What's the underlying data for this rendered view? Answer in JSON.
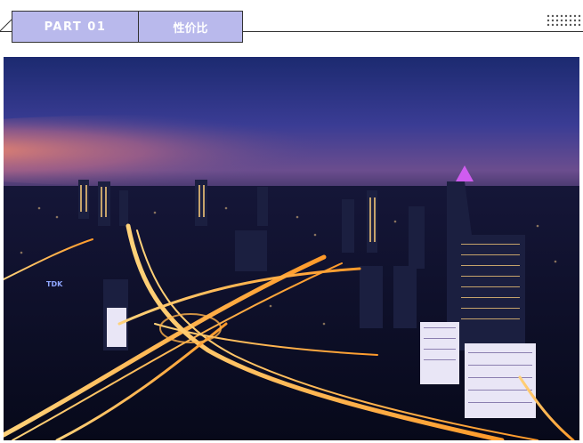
{
  "header": {
    "part_label": "PART  01",
    "section_title": "性价比"
  },
  "decor": {
    "tab_color": "#b9b9ec",
    "line_color": "#333333",
    "dot_color": "#555555",
    "dots_icon": "dot-grid-icon"
  },
  "photo": {
    "subject": "night-city-skyline",
    "sign_text": "TDK",
    "colors": {
      "sky_top": "#1e2a6a",
      "sky_mid": "#3a3a8a",
      "horizon_glow": "#e8786a",
      "ground": "#0a0e24",
      "light": "#ffb24a"
    }
  }
}
